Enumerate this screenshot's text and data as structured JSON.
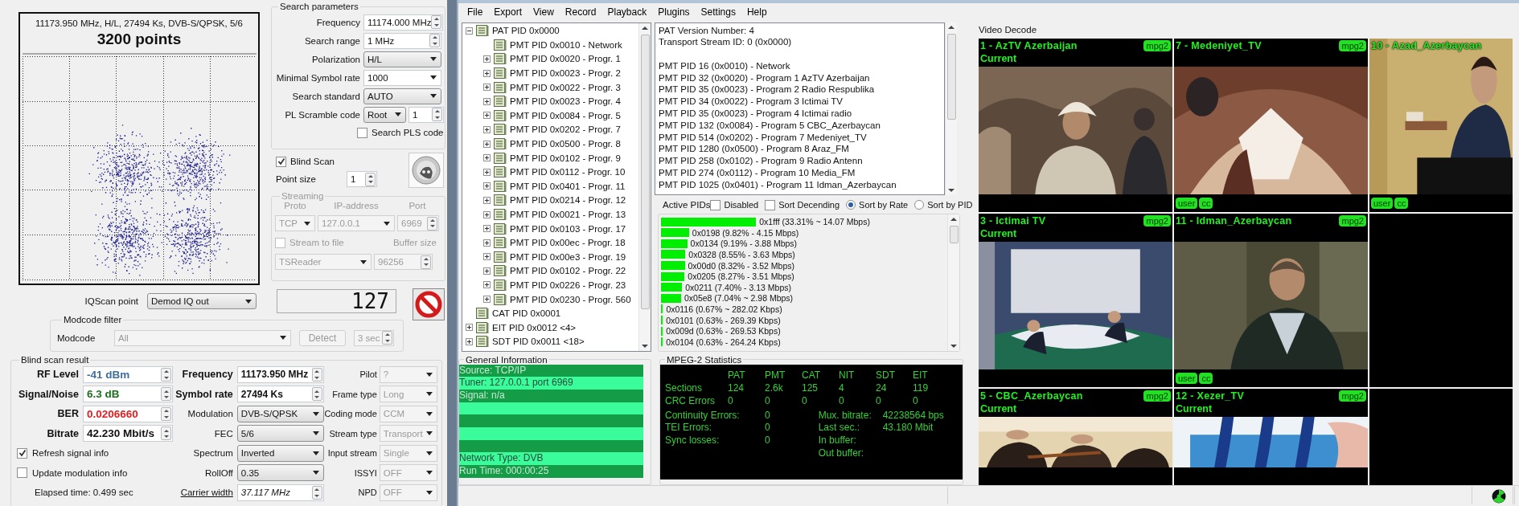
{
  "constellation": {
    "caption": "11173.950 MHz, H/L, 27494 Ks, DVB-S/QPSK, 5/6",
    "title": "3200 points"
  },
  "search_parameters": {
    "title": "Search parameters",
    "fields": [
      {
        "label": "Frequency",
        "kind": "spin",
        "value": "11174.000 MHz"
      },
      {
        "label": "Search range",
        "kind": "spin",
        "value": "1 MHz"
      },
      {
        "label": "Polarization",
        "kind": "dropdown",
        "value": "H/L"
      },
      {
        "label": "Minimal Symbol rate",
        "kind": "combo",
        "value": "1000"
      },
      {
        "label": "Search standard",
        "kind": "dropdown",
        "value": "AUTO"
      },
      {
        "label": "PL Scramble code",
        "kind": "scramble",
        "value": "Root",
        "number": "1"
      }
    ],
    "pls_checkbox": {
      "label": "Search PLS code",
      "checked": false
    }
  },
  "blind_scan": {
    "label": "Blind Scan",
    "checked": true
  },
  "point_size": {
    "label": "Point size",
    "value": "1"
  },
  "streaming": {
    "title": "Streaming",
    "disabled": true,
    "columns": [
      "Proto",
      "IP-address",
      "Port"
    ],
    "proto": "TCP",
    "ip": "127.0.0.1",
    "port": "6969",
    "stream_to_file": {
      "label": "Stream to file",
      "checked": false
    },
    "buffer_label": "Buffer size",
    "format": "TSReader",
    "buffer_size": "96256"
  },
  "counter": "127",
  "iqscan_point": {
    "label": "IQScan point",
    "value": "Demod IQ out"
  },
  "modcode_filter": {
    "title": "Modcode filter",
    "disabled": true,
    "label": "Modcode",
    "value": "All",
    "detect": "Detect",
    "interval": "3 sec"
  },
  "blind_scan_result": {
    "title": "Blind scan result",
    "signal": [
      {
        "label": "RF Level",
        "value": "-41 dBm",
        "color": "#3f6e9a"
      },
      {
        "label": "Signal/Noise",
        "value": "6.3 dB",
        "color": "#1e6e1e"
      },
      {
        "label": "BER",
        "value": "0.0206660",
        "color": "#e02020"
      },
      {
        "label": "Bitrate",
        "value": "42.230 Mbit/s",
        "color": "#111111"
      }
    ],
    "checkboxes": [
      {
        "label": "Refresh signal info",
        "checked": true
      },
      {
        "label": "Update modulation info",
        "checked": false
      }
    ],
    "elapsed": "Elapsed time: 0.499 sec",
    "modulation": [
      {
        "label": "Frequency",
        "kind": "spin-bold",
        "value": "11173.950 MHz"
      },
      {
        "label": "Symbol rate",
        "kind": "spin-bold",
        "value": "27494 Ks"
      },
      {
        "label": "Modulation",
        "kind": "dropdown",
        "value": "DVB-S/QPSK"
      },
      {
        "label": "FEC",
        "kind": "dropdown",
        "value": "5/6"
      },
      {
        "label": "Spectrum",
        "kind": "dropdown",
        "value": "Inverted"
      },
      {
        "label": "RollOff",
        "kind": "dropdown",
        "value": "0.35"
      },
      {
        "label": "Carrier width",
        "kind": "link-spin",
        "value": "37.117 MHz"
      }
    ],
    "stream": [
      {
        "label": "Pilot",
        "value": "?",
        "disabled": true
      },
      {
        "label": "Frame type",
        "value": "Long",
        "disabled": true
      },
      {
        "label": "Coding mode",
        "value": "CCM",
        "disabled": true
      },
      {
        "label": "Stream type",
        "value": "Transport",
        "disabled": true
      },
      {
        "label": "Input stream",
        "value": "Single",
        "disabled": true
      },
      {
        "label": "ISSYI",
        "value": "OFF",
        "disabled": true
      },
      {
        "label": "NPD",
        "value": "OFF",
        "disabled": true
      }
    ]
  },
  "menu": [
    "File",
    "Export",
    "View",
    "Record",
    "Playback",
    "Plugins",
    "Settings",
    "Help"
  ],
  "tree": [
    {
      "label": "PAT PID 0x0000",
      "expanded": true,
      "children": [
        {
          "label": "PMT PID 0x0010 - Network"
        },
        {
          "label": "PMT PID 0x0020 - Progr. 1",
          "expanded": false
        },
        {
          "label": "PMT PID 0x0023 - Progr. 2",
          "expanded": false
        },
        {
          "label": "PMT PID 0x0022 - Progr. 3",
          "expanded": false
        },
        {
          "label": "PMT PID 0x0023 - Progr. 4",
          "expanded": false
        },
        {
          "label": "PMT PID 0x0084 - Progr. 5",
          "expanded": false
        },
        {
          "label": "PMT PID 0x0202 - Progr. 7",
          "expanded": false
        },
        {
          "label": "PMT PID 0x0500 - Progr. 8",
          "expanded": false
        },
        {
          "label": "PMT PID 0x0102 - Progr. 9",
          "expanded": false
        },
        {
          "label": "PMT PID 0x0112 - Progr. 10",
          "expanded": false
        },
        {
          "label": "PMT PID 0x0401 - Progr. 11",
          "expanded": false
        },
        {
          "label": "PMT PID 0x0214 - Progr. 12",
          "expanded": false
        },
        {
          "label": "PMT PID 0x0021 - Progr. 13",
          "expanded": false
        },
        {
          "label": "PMT PID 0x0103 - Progr. 17",
          "expanded": false
        },
        {
          "label": "PMT PID 0x00ec - Progr. 18",
          "expanded": false
        },
        {
          "label": "PMT PID 0x00e3 - Progr. 19",
          "expanded": false
        },
        {
          "label": "PMT PID 0x0102 - Progr. 22",
          "expanded": false
        },
        {
          "label": "PMT PID 0x0226 - Progr. 23",
          "expanded": false
        },
        {
          "label": "PMT PID 0x0230 - Progr. 560",
          "expanded": false
        }
      ]
    },
    {
      "label": "CAT PID 0x0001"
    },
    {
      "label": "EIT PID 0x0012 <4>",
      "expanded": false
    },
    {
      "label": "SDT PID 0x0011 <18>",
      "expanded": false
    }
  ],
  "pat_info": {
    "header_lines": [
      "PAT Version Number: 4",
      "Transport Stream ID: 0 (0x0000)"
    ],
    "pmt_lines": [
      "PMT PID 16 (0x0010) - Network",
      "PMT PID 32 (0x0020) - Program 1 AzTV Azerbaijan",
      "PMT PID 35 (0x0023) - Program 2 Radio Respublika",
      "PMT PID 34 (0x0022) - Program 3 Ictimai TV",
      "PMT PID 35 (0x0023) - Program 4 Ictimai radio",
      "PMT PID 132 (0x0084) - Program 5 CBC_Azerbaycan",
      "PMT PID 514 (0x0202) - Program 7 Medeniyet_TV",
      "PMT PID 1280 (0x0500) - Program 8 Araz_FM",
      "PMT PID 258 (0x0102) - Program 9 Radio Antenn",
      "PMT PID 274 (0x0112) - Program 10 Media_FM",
      "PMT PID 1025 (0x0401) - Program 11 Idman_Azerbaycan"
    ]
  },
  "active_pids": {
    "title": "Active PIDs",
    "options": [
      {
        "kind": "checkbox",
        "label": "Disabled",
        "checked": false
      },
      {
        "kind": "checkbox",
        "label": "Sort Decending",
        "checked": false
      },
      {
        "kind": "radio",
        "label": "Sort by Rate",
        "selected": true
      },
      {
        "kind": "radio",
        "label": "Sort by PID",
        "selected": false
      }
    ],
    "pids": [
      {
        "label": "0x1fff (33.31% ~ 14.07 Mbps)",
        "level": 0.3331
      },
      {
        "label": "0x0198 (9.82% - 4.15 Mbps)",
        "level": 0.0982
      },
      {
        "label": "0x0134 (9.19% - 3.88 Mbps)",
        "level": 0.0919
      },
      {
        "label": "0x0328 (8.55% - 3.63 Mbps)",
        "level": 0.0855
      },
      {
        "label": "0x00d0 (8.32% - 3.52 Mbps)",
        "level": 0.0832
      },
      {
        "label": "0x0205 (8.27% - 3.51 Mbps)",
        "level": 0.0827
      },
      {
        "label": "0x0211 (7.40% - 3.13 Mbps)",
        "level": 0.074
      },
      {
        "label": "0x05e8 (7.04% ~ 2.98 Mbps)",
        "level": 0.0704
      },
      {
        "label": "0x0116 (0.67% ~ 282.02 Kbps)",
        "level": 0.0067
      },
      {
        "label": "0x0101 (0.63% - 269.39 Kbps)",
        "level": 0.0063
      },
      {
        "label": "0x009d (0.63% - 269.53 Kbps)",
        "level": 0.0063
      },
      {
        "label": "0x0104 (0.63% - 264.24 Kbps)",
        "level": 0.0063
      }
    ]
  },
  "general_information": {
    "title": "General Information",
    "lines": [
      {
        "kind": "text",
        "text": "Source: TCP/IP"
      },
      {
        "kind": "text",
        "text": "Tuner: 127.0.0.1 port 6969"
      },
      {
        "kind": "text",
        "text": "Signal: n/a"
      },
      {
        "kind": "blank"
      },
      {
        "kind": "blank"
      },
      {
        "kind": "blank"
      },
      {
        "kind": "blank"
      },
      {
        "kind": "text",
        "text": "Network Type: DVB"
      },
      {
        "kind": "text",
        "text": "Run Time: 000:00:25"
      }
    ]
  },
  "mpeg2_statistics": {
    "title": "MPEG-2 Statistics",
    "columns": [
      "PAT",
      "PMT",
      "CAT",
      "NIT",
      "SDT",
      "EIT"
    ],
    "rows": [
      {
        "label": "Sections",
        "values": [
          "124",
          "2.6k",
          "125",
          "4",
          "24",
          "119"
        ]
      },
      {
        "label": "CRC Errors",
        "values": [
          "0",
          "0",
          "0",
          "0",
          "0",
          "0"
        ]
      }
    ],
    "counters": [
      {
        "label": "Continuity Errors:",
        "value": "0"
      },
      {
        "label": "TEI Errors:",
        "value": "0"
      },
      {
        "label": "Sync losses:",
        "value": "0"
      }
    ],
    "buffers": [
      {
        "label": "Mux. bitrate:",
        "value": "42238564 bps"
      },
      {
        "label": "Last sec.:",
        "value": "43.180 Mbit"
      },
      {
        "label": "In buffer:"
      },
      {
        "label": "Out buffer:"
      }
    ]
  },
  "video_decode": {
    "title": "Video Decode",
    "tiles": [
      {
        "kind": "channel",
        "title": "1 - AzTV Azerbaijan",
        "status": "Current",
        "codec": "mpg2"
      },
      {
        "kind": "channel",
        "title": "7 - Medeniyet_TV",
        "codec": "mpg2",
        "tags": [
          "user",
          "cc"
        ]
      },
      {
        "kind": "channel",
        "title": "10 - Azad_Azerbaycan",
        "tags": [
          "user",
          "cc"
        ]
      },
      {
        "kind": "channel",
        "title": "3 - Ictimai TV",
        "status": "Current",
        "codec": "mpg2"
      },
      {
        "kind": "channel",
        "title": "11 - Idman_Azerbaycan",
        "codec": "mpg2",
        "tags": [
          "user",
          "cc"
        ]
      },
      {
        "kind": "empty"
      },
      {
        "kind": "channel",
        "title": "5 - CBC_Azerbaycan",
        "status": "Current",
        "codec": "mpg2"
      },
      {
        "kind": "channel",
        "title": "12 - Xezer_TV",
        "status": "Current",
        "codec": "mpg2"
      },
      {
        "kind": "empty"
      }
    ]
  }
}
